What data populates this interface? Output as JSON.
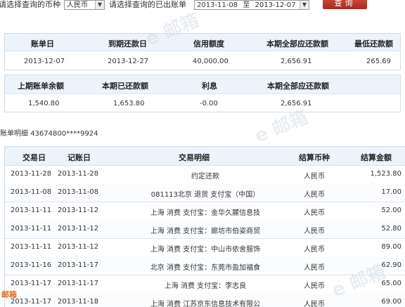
{
  "filter": {
    "currency_label": "请选择查询的币种",
    "currency_value": "人民币",
    "period_label": "请选择查询的已出账单",
    "date_from": "2013-11-08",
    "date_sep": "至",
    "date_to": "2013-12-07",
    "query_button": "查询"
  },
  "summary1": {
    "headers": [
      "账单日",
      "到期还款日",
      "信用额度",
      "本期全部应还款额",
      "最低还款额"
    ],
    "values": [
      "2013-12-07",
      "2013-12-27",
      "40,000.00",
      "2,656.91",
      "265.69"
    ]
  },
  "summary2": {
    "headers": [
      "上期账单余额",
      "本期已还款额",
      "利息",
      "本期全部应还款额"
    ],
    "values": [
      "1,540.80",
      "1,653.80",
      "-0.00",
      "2,656.91"
    ]
  },
  "account": {
    "label": "账单明细",
    "number": "43674800****9924"
  },
  "transactions": {
    "headers": [
      "交易日",
      "记账日",
      "交易明细",
      "结算币种",
      "结算金额"
    ],
    "rows": [
      [
        "2013-11-28",
        "2013-11-28",
        "约定还款",
        "人民币",
        "1,523.80"
      ],
      [
        "2013-11-08",
        "2013-11-08",
        "081113北京 退货 支付宝（中国）",
        "人民币",
        "17.00"
      ],
      [
        "2013-11-11",
        "2013-11-12",
        "上海  消费  支付宝：金华久麓信息技",
        "人民币",
        "52.00"
      ],
      [
        "2013-11-11",
        "2013-11-12",
        "上海  消费  支付宝：廊坊市伯姿商贸",
        "人民币",
        "52.80"
      ],
      [
        "2013-11-11",
        "2013-11-12",
        "上海  消费  支付宝：中山市依舍服饰",
        "人民币",
        "89.00"
      ],
      [
        "2013-11-16",
        "2013-11-17",
        "北京  消费  支付宝：东莞市盈加福食",
        "人民币",
        "62.90"
      ],
      [
        "2013-11-17",
        "2013-11-17",
        "上海  消费  支付宝：李志良",
        "人民币",
        "65.00"
      ],
      [
        "2013-11-17",
        "2013-11-18",
        "上海  消费  江苏京东信息技术有限公",
        "人民币",
        "69.00"
      ]
    ]
  },
  "badge": {
    "text": "邮箱"
  }
}
